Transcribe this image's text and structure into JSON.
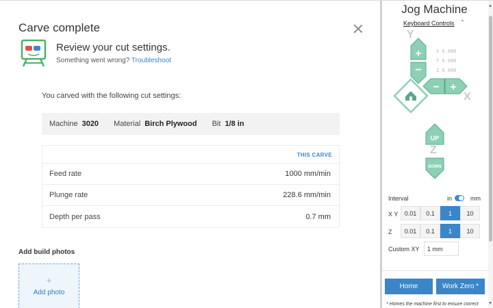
{
  "modal": {
    "title": "Carve complete",
    "review_title": "Review your cut settings.",
    "wrong_text": "Something went wrong?",
    "troubleshoot_link": "Troubleshoot",
    "carved_text": "You carved with the following cut settings:",
    "settings": {
      "machine_label": "Machine",
      "machine_value": "3020",
      "material_label": "Material",
      "material_value": "Birch Plywood",
      "bit_label": "Bit",
      "bit_value": "1/8 in"
    },
    "table": {
      "header": "THIS CARVE",
      "rows": [
        {
          "label": "Feed rate",
          "value": "1000 mm/min"
        },
        {
          "label": "Plunge rate",
          "value": "228.6 mm/min"
        },
        {
          "label": "Depth per pass",
          "value": "0.7 mm"
        }
      ]
    },
    "photos_title": "Add build photos",
    "add_photo_plus": "+",
    "add_photo_label": "Add photo"
  },
  "jog": {
    "title": "Jog Machine",
    "keyboard_controls": "Keyboard Controls",
    "caret": "⌃",
    "axis_y": "Y",
    "axis_x": "X",
    "axis_z": "Z",
    "coords": {
      "x": "X 0.000",
      "y": "Y 0.000",
      "z": "Z 0.000"
    },
    "plus": "+",
    "minus": "−",
    "up_label": "UP",
    "down_label": "DOWN",
    "interval_label": "Interval",
    "unit_in": "in",
    "unit_mm": "mm",
    "xy_label": "X Y",
    "z_label": "Z",
    "xy_steps": [
      "0.01",
      "0.1",
      "1",
      "10"
    ],
    "z_steps": [
      "0.01",
      "0.1",
      "1",
      "10"
    ],
    "selected_step": "1",
    "custom_xy_label": "Custom XY",
    "custom_xy_value": "1 mm",
    "home_button": "Home",
    "work_zero_button": "Work Zero *",
    "home_note": "* Homes the machine first to ensure correct"
  },
  "colors": {
    "jog_green": "#8dd0b6",
    "jog_green_dark": "#5aa88a",
    "accent_blue": "#3a86c8"
  }
}
